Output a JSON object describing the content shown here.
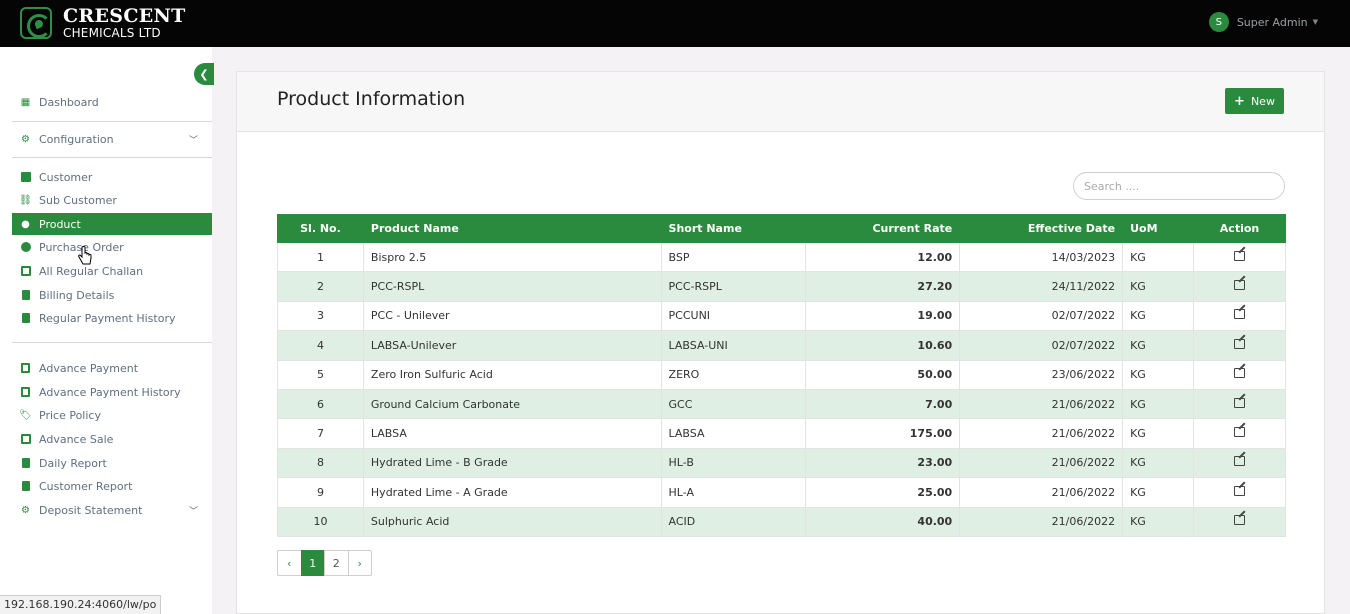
{
  "brand": {
    "line1": "CRESCENT",
    "line2": "CHEMICALS LTD"
  },
  "user": {
    "initial": "S",
    "name": "Super Admin"
  },
  "sidebar": {
    "items": [
      {
        "label": "Dashboard",
        "icon": "grid-icon"
      },
      {
        "label": "Configuration",
        "icon": "gears-icon"
      },
      {
        "label": "Customer",
        "icon": "table-icon"
      },
      {
        "label": "Sub Customer",
        "icon": "hierarchy-icon"
      },
      {
        "label": "Product",
        "icon": "product-icon"
      },
      {
        "label": "Purchase Order",
        "icon": "coins-icon"
      },
      {
        "label": "All Regular Challan",
        "icon": "card-icon"
      },
      {
        "label": "Billing Details",
        "icon": "file-icon"
      },
      {
        "label": "Regular Payment History",
        "icon": "file-icon"
      },
      {
        "label": "Advance Payment",
        "icon": "file-icon"
      },
      {
        "label": "Advance Payment History",
        "icon": "file-icon"
      },
      {
        "label": "Price Policy",
        "icon": "tags-icon"
      },
      {
        "label": "Advance Sale",
        "icon": "card-icon"
      },
      {
        "label": "Daily Report",
        "icon": "file-icon"
      },
      {
        "label": "Customer Report",
        "icon": "file-icon"
      },
      {
        "label": "Deposit Statement",
        "icon": "gears-icon"
      }
    ]
  },
  "status_url": "192.168.190.24:4060/lw/po",
  "page": {
    "title": "Product Information",
    "new_label": "New",
    "search_placeholder": "Search ....",
    "columns": [
      "Sl. No.",
      "Product Name",
      "Short Name",
      "Current Rate",
      "Effective Date",
      "UoM",
      "Action"
    ],
    "rows": [
      {
        "sl": "1",
        "name": "Bispro 2.5",
        "short": "BSP",
        "rate": "12.00",
        "date": "14/03/2023",
        "uom": "KG"
      },
      {
        "sl": "2",
        "name": "PCC-RSPL",
        "short": "PCC-RSPL",
        "rate": "27.20",
        "date": "24/11/2022",
        "uom": "KG"
      },
      {
        "sl": "3",
        "name": "PCC - Unilever",
        "short": "PCCUNI",
        "rate": "19.00",
        "date": "02/07/2022",
        "uom": "KG"
      },
      {
        "sl": "4",
        "name": "LABSA-Unilever",
        "short": "LABSA-UNI",
        "rate": "10.60",
        "date": "02/07/2022",
        "uom": "KG"
      },
      {
        "sl": "5",
        "name": "Zero Iron Sulfuric Acid",
        "short": "ZERO",
        "rate": "50.00",
        "date": "23/06/2022",
        "uom": "KG"
      },
      {
        "sl": "6",
        "name": "Ground Calcium Carbonate",
        "short": "GCC",
        "rate": "7.00",
        "date": "21/06/2022",
        "uom": "KG"
      },
      {
        "sl": "7",
        "name": "LABSA",
        "short": "LABSA",
        "rate": "175.00",
        "date": "21/06/2022",
        "uom": "KG"
      },
      {
        "sl": "8",
        "name": "Hydrated Lime - B Grade",
        "short": "HL-B",
        "rate": "23.00",
        "date": "21/06/2022",
        "uom": "KG"
      },
      {
        "sl": "9",
        "name": "Hydrated Lime - A Grade",
        "short": "HL-A",
        "rate": "25.00",
        "date": "21/06/2022",
        "uom": "KG"
      },
      {
        "sl": "10",
        "name": "Sulphuric Acid",
        "short": "ACID",
        "rate": "40.00",
        "date": "21/06/2022",
        "uom": "KG"
      }
    ],
    "pagination": {
      "prev": "‹",
      "pages": [
        "1",
        "2"
      ],
      "next": "›",
      "current": "1"
    }
  },
  "colors": {
    "accent": "#2a8a3e",
    "row_alt": "#e0efe3",
    "topbar": "#050505"
  }
}
